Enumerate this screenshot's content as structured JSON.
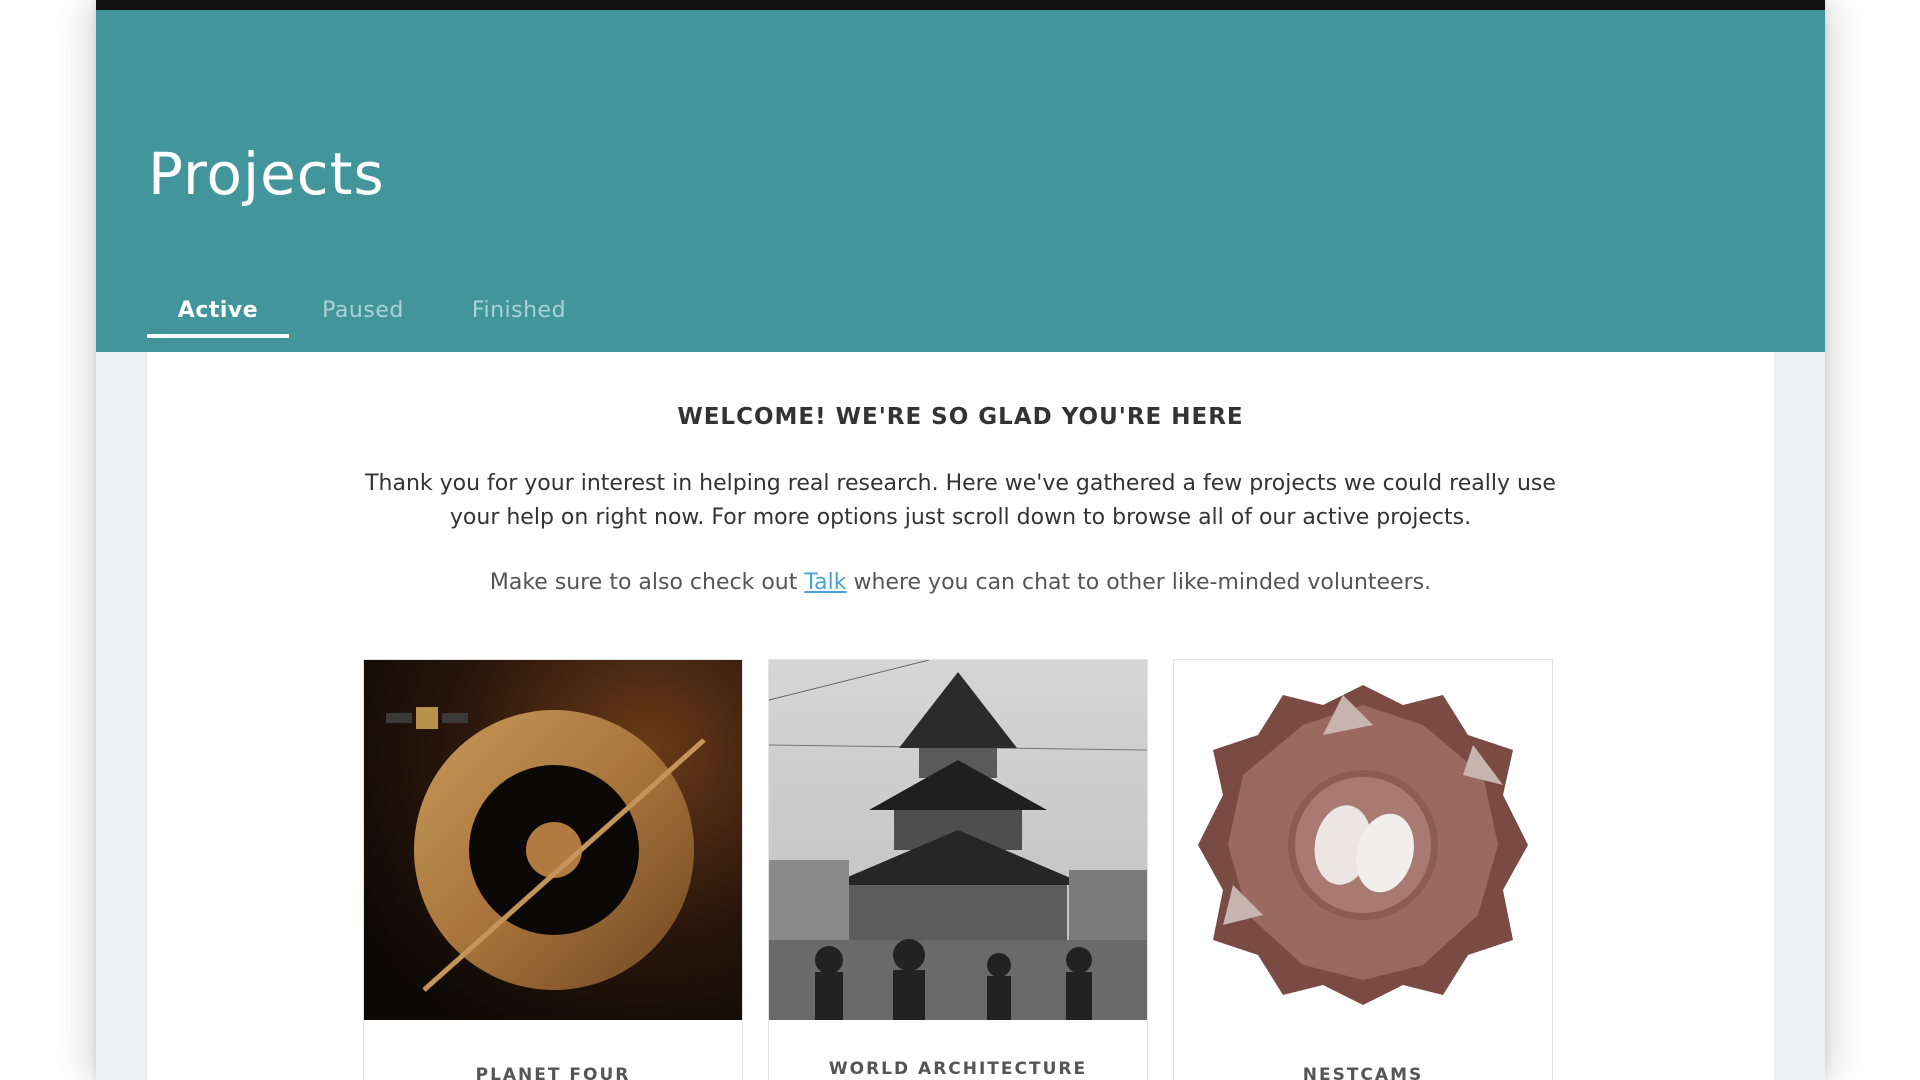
{
  "header": {
    "title": "Projects",
    "tabs": [
      {
        "label": "Active",
        "active": true
      },
      {
        "label": "Paused",
        "active": false
      },
      {
        "label": "Finished",
        "active": false
      }
    ]
  },
  "welcome": {
    "heading": "WELCOME! WE'RE SO GLAD YOU'RE HERE",
    "intro_line1": "Thank you for your interest in helping real research. Here we've gathered a few projects we could really use",
    "intro_line2": "your help on right now. For more options just scroll down to browse all of our active projects.",
    "talk_prefix": "Make sure to also check out ",
    "talk_link": "Talk",
    "talk_suffix": " where you can chat to other like-minded volunteers."
  },
  "projects": [
    {
      "title": "PLANET FOUR",
      "icon": "mars-ring-icon"
    },
    {
      "title": "WORLD ARCHITECTURE",
      "icon": "pagoda-photo"
    },
    {
      "title": "NESTCAMS",
      "icon": "nest-eggs-icon"
    }
  ],
  "colors": {
    "hero": "#42959b",
    "link": "#4aa3d8",
    "background": "#eef0f4"
  }
}
